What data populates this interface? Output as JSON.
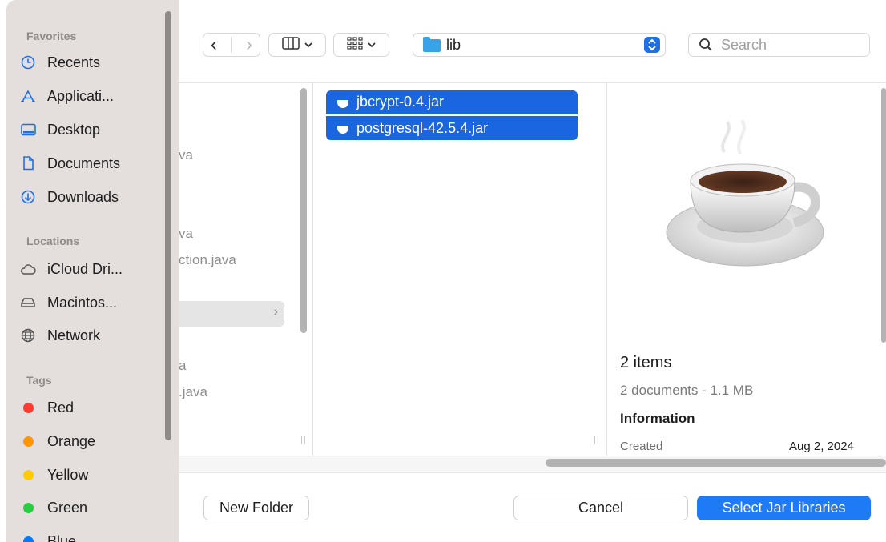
{
  "sidebar": {
    "favorites_header": "Favorites",
    "favorites": [
      {
        "label": "Recents",
        "icon": "clock-icon"
      },
      {
        "label": "Applicati...",
        "icon": "applications-icon"
      },
      {
        "label": "Desktop",
        "icon": "desktop-icon"
      },
      {
        "label": "Documents",
        "icon": "document-icon"
      },
      {
        "label": "Downloads",
        "icon": "download-icon"
      }
    ],
    "locations_header": "Locations",
    "locations": [
      {
        "label": "iCloud Dri...",
        "icon": "cloud-icon"
      },
      {
        "label": "Macintos...",
        "icon": "drive-icon"
      },
      {
        "label": "Network",
        "icon": "globe-icon"
      }
    ],
    "tags_header": "Tags",
    "tags": [
      {
        "label": "Red",
        "color": "#ff3b30"
      },
      {
        "label": "Orange",
        "color": "#ff9500"
      },
      {
        "label": "Yellow",
        "color": "#ffcc00"
      },
      {
        "label": "Green",
        "color": "#28cd41"
      },
      {
        "label": "Blue",
        "color": "#007aff"
      }
    ]
  },
  "toolbar": {
    "back_glyph": "‹",
    "forward_glyph": "›",
    "path_label": "lib",
    "search_placeholder": "Search"
  },
  "columns": {
    "ghost_items": [
      "va",
      "va",
      "ction.java",
      "a",
      ".java"
    ],
    "files": [
      {
        "name": "jbcrypt-0.4.jar",
        "selected": true
      },
      {
        "name": "postgresql-42.5.4.jar",
        "selected": true
      }
    ]
  },
  "preview": {
    "title": "2 items",
    "subtitle": "2 documents - 1.1 MB",
    "info_header": "Information",
    "created_label": "Created",
    "created_value": "Aug 2, 2024"
  },
  "buttons": {
    "new_folder": "New Folder",
    "cancel": "Cancel",
    "select": "Select Jar Libraries"
  },
  "colors": {
    "accent": "#1f7bf5",
    "selection": "#1a66e0",
    "sidebar_bg": "#e4dfdc"
  }
}
